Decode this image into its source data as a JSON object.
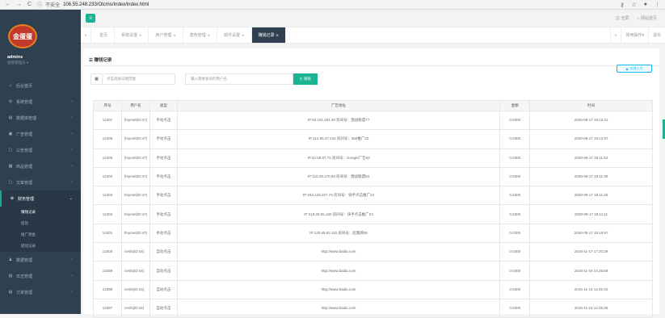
{
  "browser": {
    "security": "不安全",
    "url": "106.55.248.233/Otcms/Index/index.html"
  },
  "sidebar": {
    "logo_text": "金蛋蛋",
    "username": "admins",
    "role": "超级管理员 ▾",
    "items": [
      {
        "label": "后台首页",
        "icon": "home-icon"
      },
      {
        "label": "系统管理",
        "icon": "gear-icon"
      },
      {
        "label": "数据库管理",
        "icon": "database-icon"
      },
      {
        "label": "广告管理",
        "icon": "ad-icon"
      },
      {
        "label": "公告管理",
        "icon": "notice-icon"
      },
      {
        "label": "商品管理",
        "icon": "goods-icon"
      },
      {
        "label": "文章管理",
        "icon": "article-icon"
      },
      {
        "label": "财务管理",
        "icon": "finance-icon"
      }
    ],
    "finance_sub": [
      "赚钱记录",
      "提现",
      "推广佣金",
      "提现记录"
    ],
    "items_after": [
      {
        "label": "数据管理",
        "icon": "user-icon"
      },
      {
        "label": "日志管理",
        "icon": "log-icon"
      },
      {
        "label": "订单管理",
        "icon": "order-icon"
      }
    ]
  },
  "topbar": {
    "menu_icon": "hamburger-icon",
    "fullscreen": "全屏",
    "view_site": "网站首页"
  },
  "tabs": {
    "items": [
      "首页",
      "系统设置",
      "用户管理",
      "角色管理",
      "邮件设置",
      "赚钱记录"
    ],
    "active_index": 5,
    "right": [
      "常用操作▾",
      "退出"
    ]
  },
  "panel": {
    "title": "赚钱记录",
    "qq_button": "在线上号",
    "date_placeholder": "点击选择日期范围",
    "user_placeholder": "输入需要查询的用户名",
    "search_label": "搜索"
  },
  "table": {
    "headers": [
      "序号",
      "用户名",
      "类型",
      "广告地址",
      "金额",
      "时间"
    ],
    "rows": [
      [
        "12407",
        "fmymel(ID:47)",
        "手动点击",
        "IP:60.191.201.30 房间号：激战联盟77",
        "0.0300",
        "2020-08-17 19:12:21"
      ],
      [
        "12406",
        "fmymel(ID:47)",
        "手动点击",
        "IP:112.95.27.242 房间号：360推广22",
        "0.0300",
        "2020-08-17 19:12:07"
      ],
      [
        "12405",
        "fmymel(ID:47)",
        "手动点击",
        "IP:42.59.87.72 房间号：Google广告83",
        "0.0300",
        "2020-08-17 19:11:53"
      ],
      [
        "12404",
        "fmymel(ID:47)",
        "手动点击",
        "IP:115.29.170.58 房间号：激战联盟54",
        "0.0300",
        "2020-08-17 19:11:39"
      ],
      [
        "12403",
        "fmymel(ID:47)",
        "手动点击",
        "IP:183.129.207.73 房间号：快手点击推广22",
        "0.0300",
        "2020-08-17 19:11:25"
      ],
      [
        "12402",
        "fmymel(ID:47)",
        "手动点击",
        "IP:218.28.55.160 房间号：快手点击推广34",
        "0.0300",
        "2020-08-17 19:11:11"
      ],
      [
        "12401",
        "fmymel(ID:47)",
        "手动点击",
        "IP:120.69.92.110 房间号：赶集网36",
        "0.0300",
        "2020-08-17 19:10:57"
      ],
      [
        "12400",
        "ceshi(ID:44)",
        "自动点击",
        "http://www.baidu.com",
        "0.0300",
        "2016-11-17 17:20:29"
      ],
      [
        "12399",
        "ceshi(ID:44)",
        "自动点击",
        "http://www.baidu.com",
        "0.0300",
        "2016-11-16 14:25:58"
      ],
      [
        "12398",
        "ceshi(ID:44)",
        "自动点击",
        "http://www.baidu.com",
        "0.0300",
        "2016-11-16 14:25:42"
      ],
      [
        "12397",
        "ceshi(ID:44)",
        "自动点击",
        "http://www.baidu.com",
        "0.0300",
        "2016-11-16 14:25:25"
      ]
    ]
  },
  "colors": {
    "sidebar_bg": "#2f4050",
    "accent": "#1ab394",
    "qq": "#12b7f5"
  }
}
